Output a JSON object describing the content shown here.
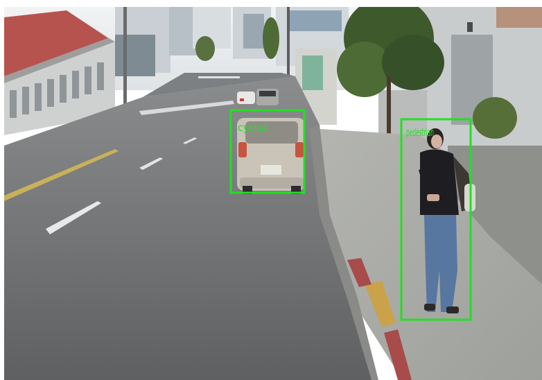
{
  "image": {
    "kind": "street-scene-with-detections"
  },
  "detections": [
    {
      "label": "cyclist",
      "color": "#22e022"
    },
    {
      "label": "pedestrian",
      "color": "#22e022"
    }
  ],
  "colors": {
    "box": "#22e022",
    "road": "#6f6f6f",
    "sidewalk": "#a4a6a2",
    "sky": "#e7ebee",
    "curb_yellow": "#c9a24a",
    "curb_red": "#a84b4b"
  }
}
